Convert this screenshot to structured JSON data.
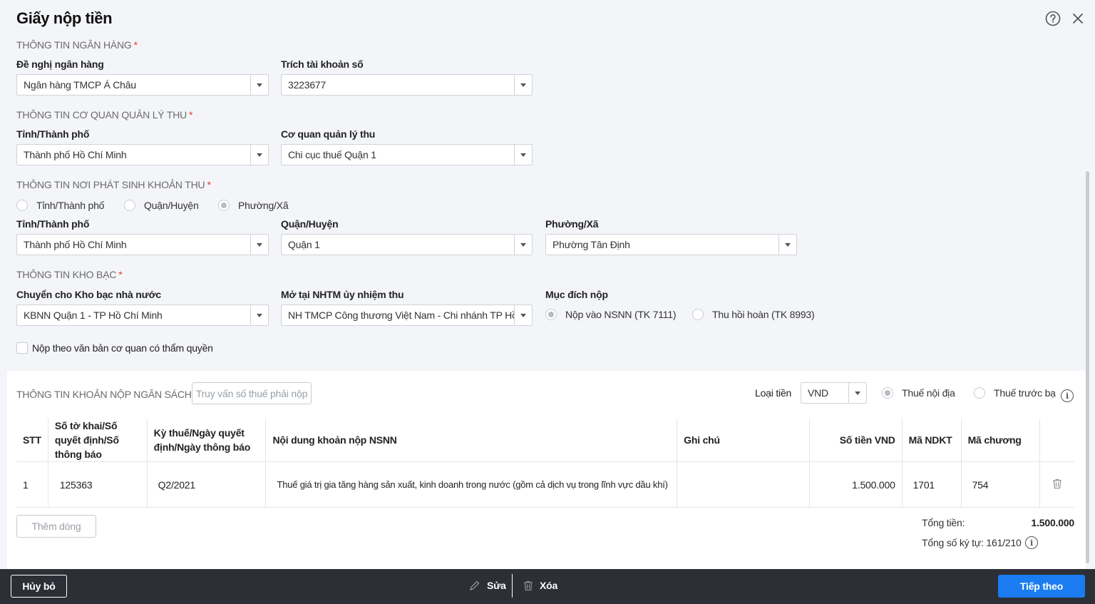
{
  "dialog": {
    "title": "Giấy nộp tiền"
  },
  "bank_section": {
    "title": "THÔNG TIN NGÂN HÀNG",
    "required": "*",
    "bank_label": "Đề nghị ngân hàng",
    "bank_value": "Ngân hàng TMCP Á Châu",
    "account_label": "Trích tài khoản số",
    "account_value": "3223677"
  },
  "agency_section": {
    "title": "THÔNG TIN CƠ QUAN QUẢN LÝ THU",
    "required": "*",
    "province_label": "Tỉnh/Thành phố",
    "province_value": "Thành phố Hồ Chí Minh",
    "agency_label": "Cơ quan quản lý thu",
    "agency_value": "Chi cục thuế Quận 1"
  },
  "origin_section": {
    "title": "THÔNG TIN NƠI PHÁT SINH KHOẢN THU",
    "required": "*",
    "radio_province": "Tỉnh/Thành phố",
    "radio_district": "Quận/Huyện",
    "radio_ward": "Phường/Xã",
    "selected": "ward",
    "province_label": "Tỉnh/Thành phố",
    "province_value": "Thành phố Hồ Chí Minh",
    "district_label": "Quận/Huyện",
    "district_value": "Quận 1",
    "ward_label": "Phường/Xã",
    "ward_value": "Phường Tân Định"
  },
  "treasury_section": {
    "title": "THÔNG TIN KHO BẠC",
    "required": "*",
    "treasury_label": "Chuyển cho Kho bạc nhà nước",
    "treasury_value": "KBNN Quận 1 - TP Hồ Chí Minh",
    "bank_label": "Mở tại NHTM ủy nhiệm thu",
    "bank_value": "NH TMCP Công thương Việt Nam - Chi nhánh TP Hồ Chí Minh",
    "purpose_label": "Mục đích nộp",
    "purpose_option_1": "Nộp vào NSNN (TK 7111)",
    "purpose_option_2": "Thu hồi hoàn (TK 8993)",
    "checkbox_label": "Nộp theo văn bản cơ quan có thẩm quyền"
  },
  "budget_section": {
    "title": "THÔNG TIN KHOẢN NỘP NGÂN SÁCH",
    "lookup_button": "Truy vấn số thuế phải nộp",
    "currency_label": "Loại tiền",
    "currency_value": "VND",
    "tax_domestic": "Thuế nội địa",
    "tax_registration": "Thuế trước bạ",
    "columns": {
      "stt": "STT",
      "decl": "Số tờ khai/Số quyết định/Số thông báo",
      "period": "Kỳ thuế/Ngày quyết định/Ngày thông báo",
      "content": "Nội dung khoản nộp NSNN",
      "note": "Ghi chú",
      "amount": "Số tiền VND",
      "ndkt": "Mã NDKT",
      "chapter": "Mã chương"
    },
    "row": {
      "stt": "1",
      "decl": "125363",
      "period": "Q2/2021",
      "content": "Thuế giá trị gia tăng hàng sản xuất, kinh doanh trong nước (gồm cả dịch vụ trong lĩnh vực dầu khí)",
      "note": "",
      "amount": "1.500.000",
      "ndkt": "1701",
      "chapter": "754"
    },
    "add_row_button": "Thêm dòng",
    "total_label": "Tổng tiền:",
    "total_value": "1.500.000",
    "char_count": "Tổng số ký tự: 161/210"
  },
  "footer": {
    "cancel": "Hủy bỏ",
    "edit": "Sửa",
    "delete": "Xóa",
    "next": "Tiếp theo"
  },
  "colors": {
    "primary": "#1a7cf0",
    "footer_bg": "#2c2f36",
    "required": "#e53935"
  },
  "icons": [
    "help-icon",
    "close-icon",
    "trash-icon",
    "pencil-icon",
    "info-icon",
    "chevron-down-icon"
  ]
}
